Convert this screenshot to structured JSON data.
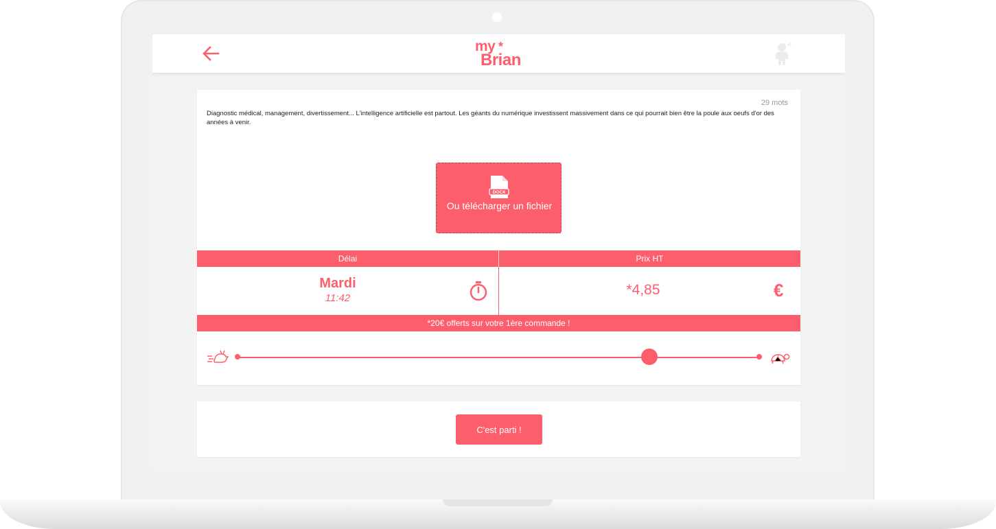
{
  "colors": {
    "accent": "#fd5e6c",
    "background": "#f3f3f3",
    "card": "#ffffff"
  },
  "header": {
    "back_icon": "arrow-left-icon",
    "logo_top": "my",
    "logo_bottom": "Brian",
    "avatar_icon": "kid-avatar-icon"
  },
  "editor": {
    "word_count": "29 mots",
    "text": "Diagnostic médical, management, divertissement... L'intelligence artificielle est partout. Les géants du numérique investissent massivement dans ce qui pourrait bien être la poule aux oeufs d'or des années à venir.",
    "upload_icon": "docx-file-icon",
    "upload_badge": "DOCX",
    "upload_label": "Ou télécharger un fichier"
  },
  "quote": {
    "delay_header": "Délai",
    "price_header": "Prix HT",
    "delay_day": "Mardi",
    "delay_time": "11:42",
    "timer_icon": "stopwatch-icon",
    "price_value": "*4,85",
    "currency_icon": "euro-icon",
    "currency_symbol": "€",
    "offer_text": "*20€ offerts sur votre 1ère commande !"
  },
  "speed_slider": {
    "fast_icon": "rabbit-icon",
    "slow_icon": "turtle-icon",
    "value_fraction": 0.79
  },
  "submit": {
    "label": "C'est parti !"
  }
}
